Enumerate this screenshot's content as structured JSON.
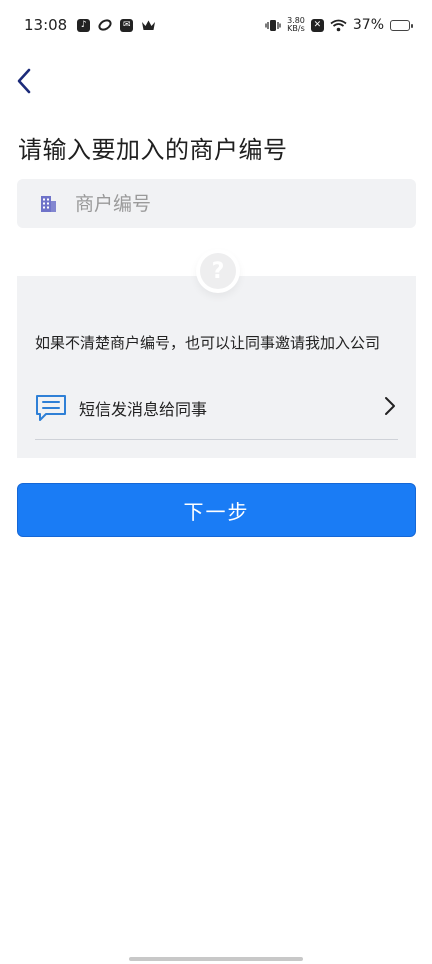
{
  "status_bar": {
    "time": "13:08",
    "net_speed_value": "3.80",
    "net_speed_unit": "KB/s",
    "battery_percent": "37%",
    "battery_level": 0.37
  },
  "header": {
    "title": "请输入要加入的商户编号"
  },
  "merchant_input": {
    "placeholder": "商户编号",
    "value": "",
    "icon": "building-icon"
  },
  "help": {
    "icon": "question-mark-icon",
    "hint_text": "如果不清楚商户编号，也可以让同事邀请我加入公司",
    "sms_option": {
      "icon": "chat-message-icon",
      "label": "短信发消息给同事"
    }
  },
  "actions": {
    "next_label": "下一步"
  },
  "colors": {
    "primary": "#1a7cf5",
    "nav_icon": "#1c2b7a",
    "building_icon": "#6f73c9",
    "sms_icon": "#2f80d6",
    "input_bg": "#f1f2f4"
  }
}
